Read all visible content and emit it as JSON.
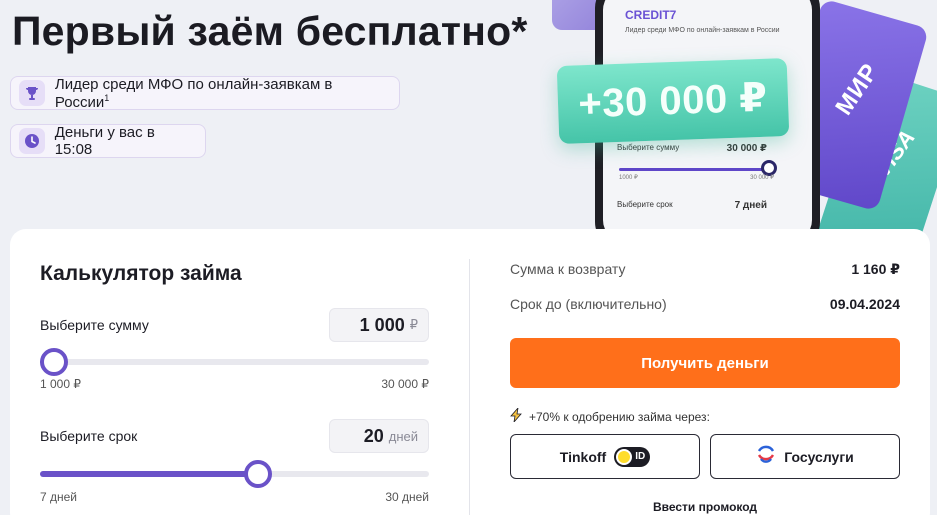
{
  "hero": {
    "title": "Первый заём бесплатно*",
    "badges": [
      {
        "text": "Лидер среди МФО по онлайн-заявкам в России",
        "sup": "1",
        "icon": "trophy-icon"
      },
      {
        "text": "Деньги у вас в 15:08",
        "icon": "clock-icon"
      }
    ]
  },
  "art": {
    "phone_logo": "CREDIT7",
    "phone_leader": "Лидер среди МФО по онлайн-заявкам в России",
    "bonus": "+30 000 ₽",
    "phone_amount_label": "Выберите сумму",
    "phone_amount_value": "30 000 ₽",
    "phone_min": "1000 ₽",
    "phone_max": "30 000 ₽",
    "phone_term_label": "Выберите срок",
    "phone_term_value": "7 дней",
    "card_mir": "МИР",
    "card_visa": "VISA"
  },
  "calculator": {
    "title": "Калькулятор займа",
    "amount": {
      "label": "Выберите сумму",
      "value": "1 000",
      "unit": "₽",
      "min": "1 000 ₽",
      "max": "30 000 ₽",
      "level": 0.0
    },
    "term": {
      "label": "Выберите срок",
      "value": "20",
      "unit": "дней",
      "min": "7 дней",
      "max": "30 дней",
      "level": 0.565
    }
  },
  "summary": {
    "return_label": "Сумма к возврату",
    "return_value": "1 160 ₽",
    "due_label": "Срок до (включительно)",
    "due_value": "09.04.2024",
    "cta": "Получить деньги",
    "approve_text": "+70% к одобрению займа через:",
    "tinkoff_label": "Tinkoff",
    "tinkoff_badge": "ID",
    "gosuslugi_label": "Госуслуги",
    "promo": "Ввести промокод"
  },
  "colors": {
    "accent": "#6a52c8",
    "cta": "#ff6f1a",
    "bonus": "#4ec9ab",
    "background": "#eef0f5"
  }
}
